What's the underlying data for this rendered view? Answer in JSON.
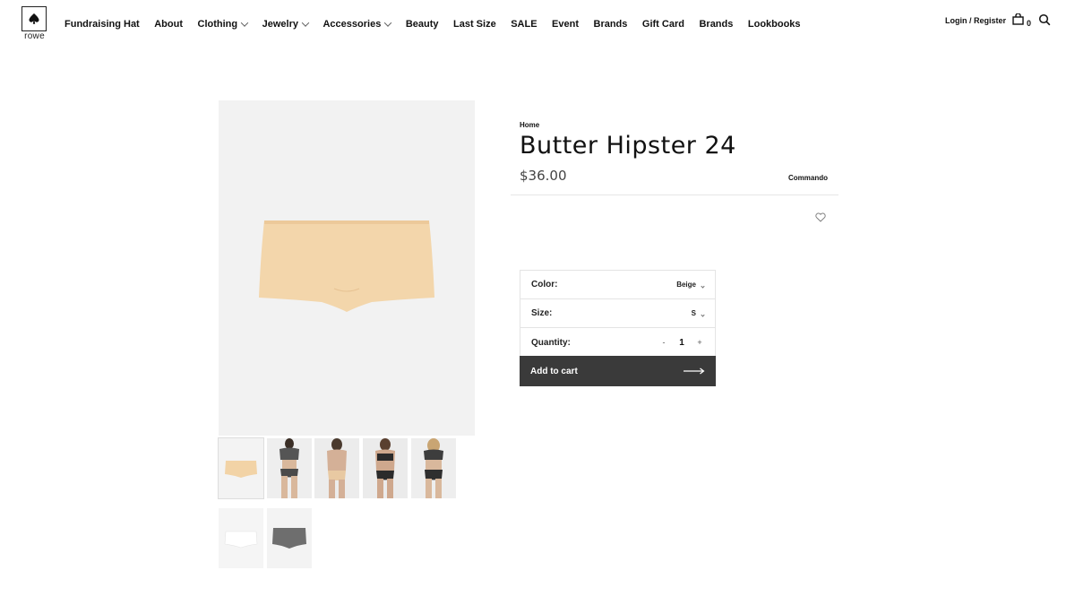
{
  "brand": {
    "logo_text": "rowe"
  },
  "nav": {
    "items": [
      {
        "label": "Fundraising Hat",
        "dropdown": false
      },
      {
        "label": "About",
        "dropdown": false
      },
      {
        "label": "Clothing",
        "dropdown": true
      },
      {
        "label": "Jewelry",
        "dropdown": true
      },
      {
        "label": "Accessories",
        "dropdown": true
      },
      {
        "label": "Beauty",
        "dropdown": false
      },
      {
        "label": "Last Size",
        "dropdown": false
      },
      {
        "label": "SALE",
        "dropdown": false
      },
      {
        "label": "Event",
        "dropdown": false
      },
      {
        "label": "Brands",
        "dropdown": false
      },
      {
        "label": "Gift Card",
        "dropdown": false
      },
      {
        "label": "Brands",
        "dropdown": false
      },
      {
        "label": "Lookbooks",
        "dropdown": false
      }
    ]
  },
  "header": {
    "login_label": "Login / Register",
    "cart_count": "0"
  },
  "product": {
    "breadcrumb": "Home",
    "title": "Butter Hipster 24",
    "price": "$36.00",
    "brand": "Commando",
    "thumbnails": [
      "beige-flat",
      "model-front-grey",
      "model-back-beige",
      "model-front-black",
      "model-back-black",
      "white-flat",
      "grey-flat"
    ],
    "selected_thumbnail": 0
  },
  "options": {
    "color_label": "Color:",
    "color_value": "Beige",
    "size_label": "Size:",
    "size_value": "S",
    "quantity_label": "Quantity:",
    "quantity_value": "1",
    "minus": "-",
    "plus": "+"
  },
  "cart": {
    "add_label": "Add to cart"
  },
  "colors": {
    "button_bg": "#3a3a3a",
    "image_bg": "#f2f2f2",
    "beige": "#f2d5aa"
  }
}
